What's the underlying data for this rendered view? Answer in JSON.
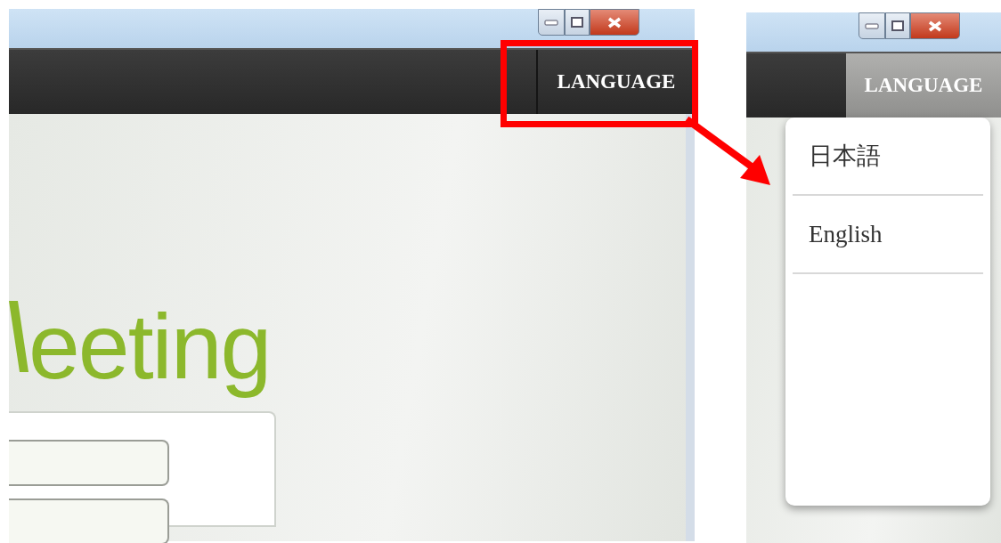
{
  "left_window": {
    "nav": {
      "language_button": {
        "label": "LANGUAGE",
        "selected": false
      }
    },
    "logo": {
      "text": "eeting"
    },
    "highlighted": true
  },
  "right_window": {
    "nav": {
      "language_button": {
        "label": "LANGUAGE",
        "selected": true
      }
    },
    "language_menu": {
      "items": [
        {
          "label": "日本語"
        },
        {
          "label": "English"
        }
      ]
    }
  }
}
